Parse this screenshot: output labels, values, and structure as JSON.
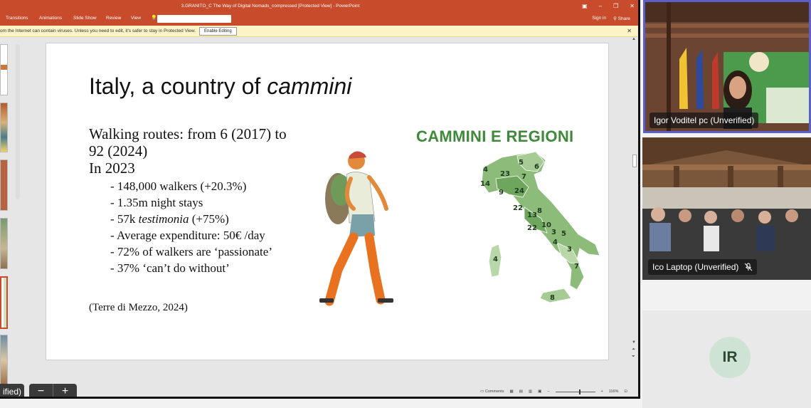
{
  "powerpoint": {
    "window_title": "3.GRANITO_C The Way of Digital Nomads_compressed [Protected View] - PowerPoint",
    "ribbon_tabs": [
      "Transitions",
      "Animations",
      "Slide Show",
      "Review",
      "View"
    ],
    "sign_in": "Sign in",
    "share": "Share",
    "protected_message": "om the Internet can contain viruses. Unless you need to edit, it's safer to stay in Protected View.",
    "enable_editing": "Enable Editing",
    "slide": {
      "title_prefix": "Italy, a country of ",
      "title_italic": "cammini",
      "walking_routes_line1": "Walking routes: from 6 (2017) to",
      "walking_routes_line2": "92 (2024)",
      "year_heading": "In 2023",
      "bullets": [
        "- 148,000 walkers (+20.3%)",
        "- 1.35m night stays",
        "- 72% of walkers are ‘passionate’",
        "- 37% ‘can’t do without’"
      ],
      "bullet_testimonia_prefix": "- 57k ",
      "bullet_testimonia_italic": "testimonia",
      "bullet_testimonia_suffix": " (+75%)",
      "bullet_expenditure": "- Average expenditure: 50€ /day",
      "source": "(Terre di Mezzo, 2024)",
      "map_title": "CAMMINI E REGIONI",
      "region_counts": [
        "4",
        "5",
        "6",
        "23",
        "7",
        "14",
        "9",
        "24",
        "22",
        "13",
        "8",
        "10",
        "22",
        "3",
        "5",
        "4",
        "3",
        "4",
        "7",
        "8"
      ]
    },
    "status": {
      "comments": "Comments",
      "zoom": "116%"
    }
  },
  "meeting": {
    "self_view_label": "ified)",
    "zoom_minus": "−",
    "zoom_plus": "+",
    "participants": [
      {
        "name": "Igor Voditel pc (Unverified)"
      },
      {
        "name": "Ico Laptop (Unverified)"
      },
      {
        "initials": "IR"
      }
    ]
  },
  "colors": {
    "ppt_accent": "#c84b2c",
    "map_green": "#3f8a3a",
    "active_speaker": "#5b5fc7"
  }
}
